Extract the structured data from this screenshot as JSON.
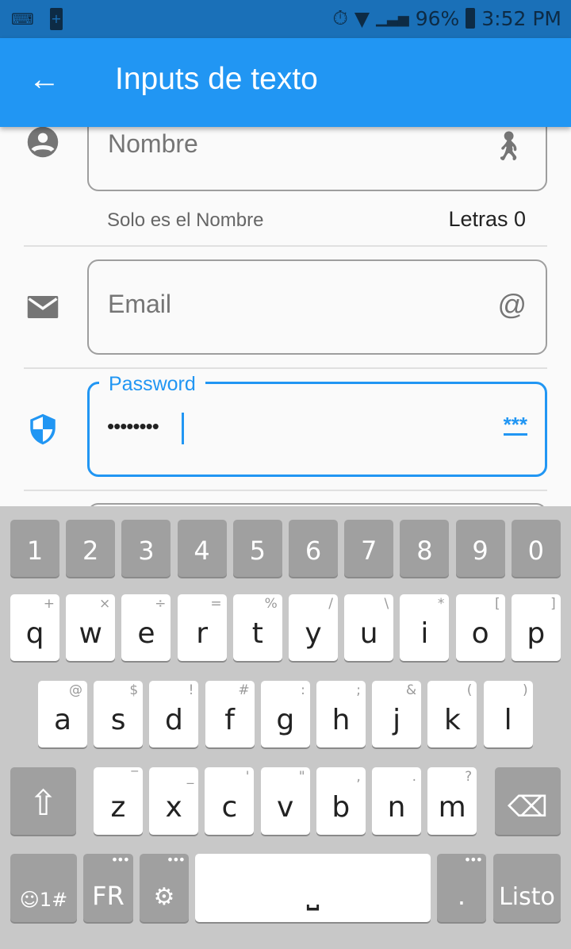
{
  "status": {
    "battery": "96%",
    "time": "3:52 PM"
  },
  "appbar": {
    "title": "Inputs de texto"
  },
  "form": {
    "nombre": {
      "label": "Nombre",
      "helper": "Solo es el Nombre",
      "counter": "Letras 0"
    },
    "email": {
      "label": "Email"
    },
    "password": {
      "label": "Password",
      "value": "••••••••",
      "suffix": "***",
      "accent": "#2196F3"
    }
  },
  "keyboard": {
    "numbers": [
      "1",
      "2",
      "3",
      "4",
      "5",
      "6",
      "7",
      "8",
      "9",
      "0"
    ],
    "row1": [
      [
        "q",
        "+"
      ],
      [
        "w",
        "×"
      ],
      [
        "e",
        "÷"
      ],
      [
        "r",
        "="
      ],
      [
        "t",
        "%"
      ],
      [
        "y",
        "/"
      ],
      [
        "u",
        "\\"
      ],
      [
        "i",
        "*"
      ],
      [
        "o",
        "["
      ],
      [
        "p",
        "]"
      ]
    ],
    "row2": [
      [
        "a",
        "@"
      ],
      [
        "s",
        "$"
      ],
      [
        "d",
        "!"
      ],
      [
        "f",
        "#"
      ],
      [
        "g",
        ":"
      ],
      [
        "h",
        ";"
      ],
      [
        "j",
        "&"
      ],
      [
        "k",
        "("
      ],
      [
        "l",
        ")"
      ]
    ],
    "row3": [
      [
        "z",
        "‾"
      ],
      [
        "x",
        "_"
      ],
      [
        "c",
        "'"
      ],
      [
        "v",
        "\""
      ],
      [
        "b",
        ","
      ],
      [
        "n",
        "."
      ],
      [
        "m",
        "?"
      ]
    ],
    "symbols": "☺1#",
    "lang": "FR",
    "period": ".",
    "done": "Listo"
  }
}
